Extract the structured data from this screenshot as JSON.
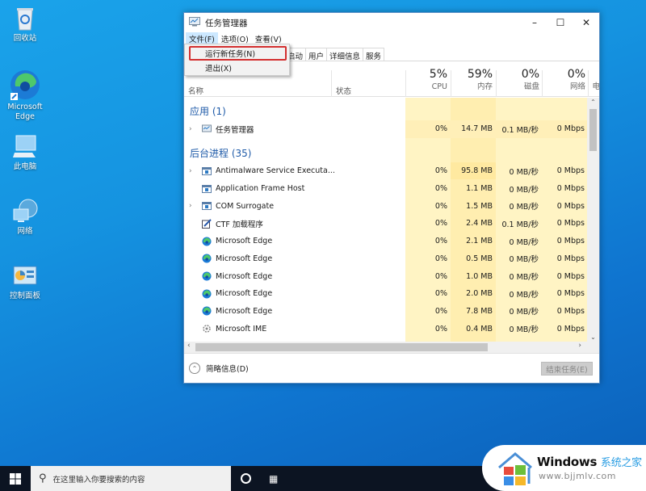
{
  "desktop": {
    "icons": [
      {
        "label": "回收站",
        "icon": "recycle-bin-icon"
      },
      {
        "label": "Microsoft Edge",
        "icon": "edge-icon"
      },
      {
        "label": "此电脑",
        "icon": "this-pc-icon"
      },
      {
        "label": "网络",
        "icon": "network-icon"
      },
      {
        "label": "控制面板",
        "icon": "control-panel-icon"
      }
    ]
  },
  "window": {
    "title": "任务管理器",
    "controls": {
      "minimize": "–",
      "maximize": "☐",
      "close": "✕"
    },
    "menu": [
      "文件(F)",
      "选项(O)",
      "查看(V)"
    ],
    "file_menu": {
      "items": [
        "运行新任务(N)",
        "退出(X)"
      ],
      "highlighted": "运行新任务(N)"
    },
    "tabs": [
      "启动",
      "用户",
      "详细信息",
      "服务"
    ],
    "columns": {
      "name": "名称",
      "status": "状态",
      "cpu": {
        "pct": "5%",
        "label": "CPU"
      },
      "memory": {
        "pct": "59%",
        "label": "内存"
      },
      "disk": {
        "pct": "0%",
        "label": "磁盘"
      },
      "network": {
        "pct": "0%",
        "label": "网络"
      },
      "power": {
        "label": "电"
      }
    },
    "groups": {
      "apps": "应用 (1)",
      "background": "后台进程 (35)"
    },
    "app_rows": [
      {
        "name": "任务管理器",
        "icon": "task-manager-icon",
        "expandable": true,
        "cpu": "0%",
        "memory": "14.7 MB",
        "disk": "0.1 MB/秒",
        "network": "0 Mbps"
      }
    ],
    "bg_rows": [
      {
        "name": "Antimalware Service Executa...",
        "icon": "service-icon",
        "expandable": true,
        "cpu": "0%",
        "memory": "95.8 MB",
        "disk": "0 MB/秒",
        "network": "0 Mbps"
      },
      {
        "name": "Application Frame Host",
        "icon": "service-icon",
        "expandable": false,
        "cpu": "0%",
        "memory": "1.1 MB",
        "disk": "0 MB/秒",
        "network": "0 Mbps"
      },
      {
        "name": "COM Surrogate",
        "icon": "service-icon",
        "expandable": true,
        "cpu": "0%",
        "memory": "1.5 MB",
        "disk": "0 MB/秒",
        "network": "0 Mbps"
      },
      {
        "name": "CTF 加载程序",
        "icon": "ctf-loader-icon",
        "expandable": false,
        "cpu": "0%",
        "memory": "2.4 MB",
        "disk": "0.1 MB/秒",
        "network": "0 Mbps"
      },
      {
        "name": "Microsoft Edge",
        "icon": "edge-icon",
        "expandable": false,
        "cpu": "0%",
        "memory": "2.1 MB",
        "disk": "0 MB/秒",
        "network": "0 Mbps"
      },
      {
        "name": "Microsoft Edge",
        "icon": "edge-icon",
        "expandable": false,
        "cpu": "0%",
        "memory": "0.5 MB",
        "disk": "0 MB/秒",
        "network": "0 Mbps"
      },
      {
        "name": "Microsoft Edge",
        "icon": "edge-icon",
        "expandable": false,
        "cpu": "0%",
        "memory": "1.0 MB",
        "disk": "0 MB/秒",
        "network": "0 Mbps"
      },
      {
        "name": "Microsoft Edge",
        "icon": "edge-icon",
        "expandable": false,
        "cpu": "0%",
        "memory": "2.0 MB",
        "disk": "0 MB/秒",
        "network": "0 Mbps"
      },
      {
        "name": "Microsoft Edge",
        "icon": "edge-icon",
        "expandable": false,
        "cpu": "0%",
        "memory": "7.8 MB",
        "disk": "0 MB/秒",
        "network": "0 Mbps"
      },
      {
        "name": "Microsoft IME",
        "icon": "ime-icon",
        "expandable": false,
        "cpu": "0%",
        "memory": "0.4 MB",
        "disk": "0 MB/秒",
        "network": "0 Mbps"
      }
    ],
    "footer": {
      "fewer_details": "简略信息(D)",
      "end_task": "结束任务(E)"
    }
  },
  "taskbar": {
    "search_placeholder": "在这里输入你要搜索的内容"
  },
  "watermark": {
    "brand": "Windows",
    "brand_cn": "系统之家",
    "url": "www.bjjmlv.com"
  },
  "colors": {
    "heat_light": "#fff4c4",
    "heat_medium": "#ffe9a0",
    "group_blue": "#1e5aa8",
    "highlight_red": "#d32f2f"
  }
}
